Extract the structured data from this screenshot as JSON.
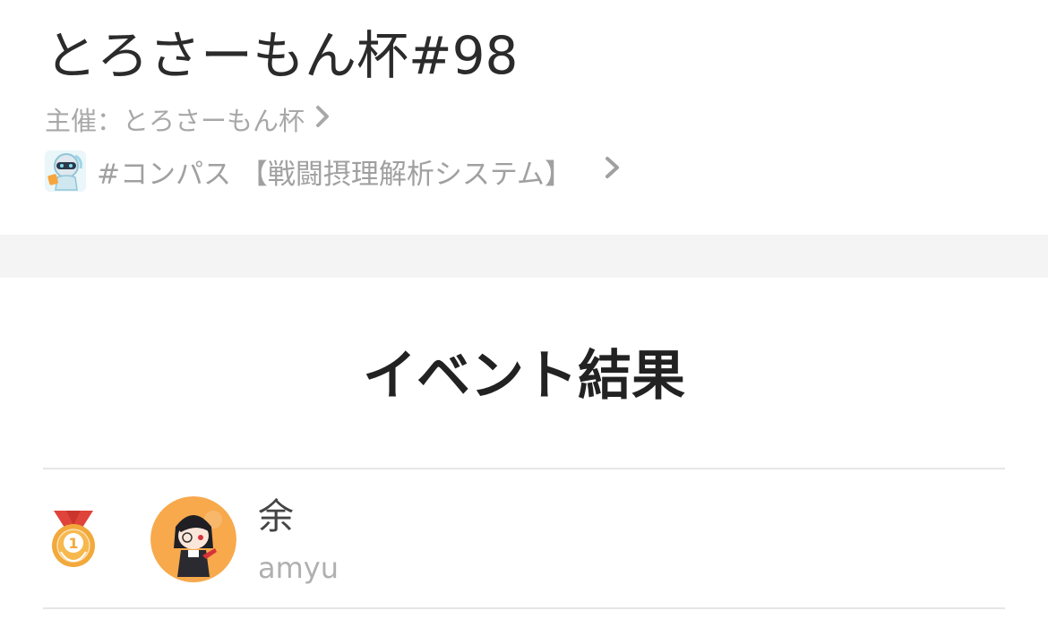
{
  "event": {
    "title": "とろさーもん杯#98",
    "organizer_label": "主催：とろさーもん杯",
    "game_label": "#コンパス 【戦闘摂理解析システム】",
    "chevron": "chevron-right-icon"
  },
  "results": {
    "heading": "イベント結果",
    "entries": [
      {
        "rank": 1,
        "medal_icon": "gold-medal-icon",
        "name": "余",
        "user_id": "amyu"
      }
    ]
  },
  "colors": {
    "medal_gold": "#f2a93b",
    "medal_ribbon": "#e0433a",
    "avatar_bg": "#f7a94c",
    "band": "#f4f4f4"
  }
}
